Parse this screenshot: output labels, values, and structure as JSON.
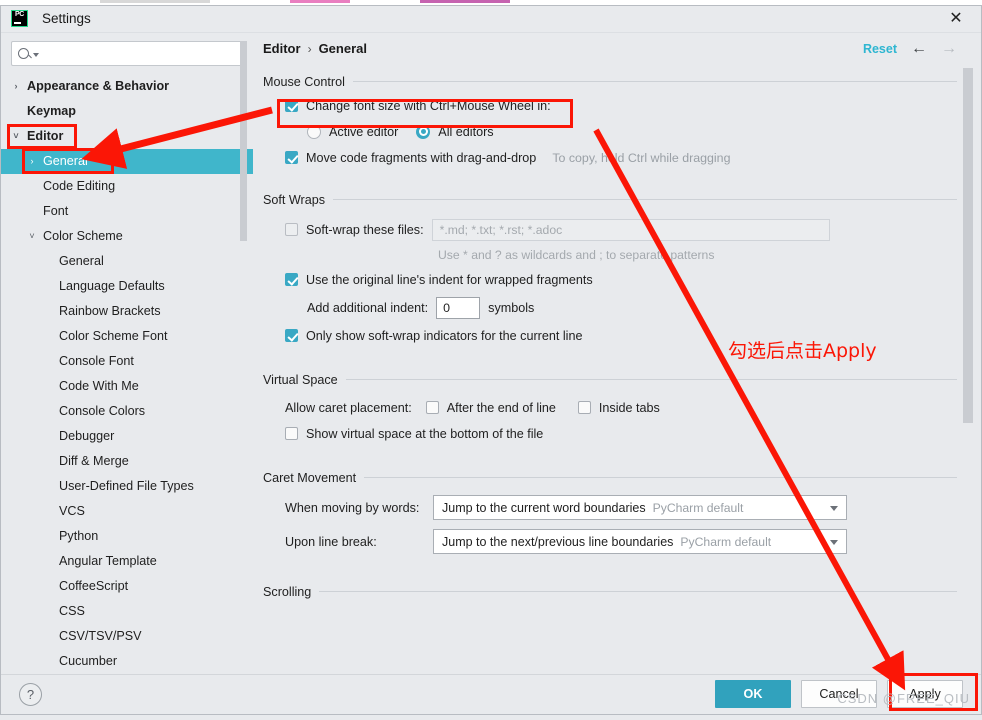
{
  "window": {
    "title": "Settings",
    "app_icon": "pycharm-logo-icon",
    "close_icon": "close-icon"
  },
  "search": {
    "value": "",
    "placeholder": "",
    "icon": "search-icon",
    "caret_icon": "chevron-down-icon"
  },
  "sidebar": {
    "items": [
      {
        "label": "Appearance & Behavior",
        "indent": 0,
        "chevron": "›",
        "bold": true,
        "selected": false
      },
      {
        "label": "Keymap",
        "indent": 0,
        "chevron": "",
        "bold": true,
        "selected": false
      },
      {
        "label": "Editor",
        "indent": 0,
        "chevron": "˅",
        "bold": true,
        "selected": false
      },
      {
        "label": "General",
        "indent": 1,
        "chevron": "›",
        "bold": false,
        "selected": true
      },
      {
        "label": "Code Editing",
        "indent": 1,
        "chevron": "",
        "bold": false,
        "selected": false
      },
      {
        "label": "Font",
        "indent": 1,
        "chevron": "",
        "bold": false,
        "selected": false
      },
      {
        "label": "Color Scheme",
        "indent": 1,
        "chevron": "˅",
        "bold": false,
        "selected": false
      },
      {
        "label": "General",
        "indent": 2,
        "chevron": "",
        "bold": false,
        "selected": false
      },
      {
        "label": "Language Defaults",
        "indent": 2,
        "chevron": "",
        "bold": false,
        "selected": false
      },
      {
        "label": "Rainbow Brackets",
        "indent": 2,
        "chevron": "",
        "bold": false,
        "selected": false
      },
      {
        "label": "Color Scheme Font",
        "indent": 2,
        "chevron": "",
        "bold": false,
        "selected": false
      },
      {
        "label": "Console Font",
        "indent": 2,
        "chevron": "",
        "bold": false,
        "selected": false
      },
      {
        "label": "Code With Me",
        "indent": 2,
        "chevron": "",
        "bold": false,
        "selected": false
      },
      {
        "label": "Console Colors",
        "indent": 2,
        "chevron": "",
        "bold": false,
        "selected": false
      },
      {
        "label": "Debugger",
        "indent": 2,
        "chevron": "",
        "bold": false,
        "selected": false
      },
      {
        "label": "Diff & Merge",
        "indent": 2,
        "chevron": "",
        "bold": false,
        "selected": false
      },
      {
        "label": "User-Defined File Types",
        "indent": 2,
        "chevron": "",
        "bold": false,
        "selected": false
      },
      {
        "label": "VCS",
        "indent": 2,
        "chevron": "",
        "bold": false,
        "selected": false
      },
      {
        "label": "Python",
        "indent": 2,
        "chevron": "",
        "bold": false,
        "selected": false
      },
      {
        "label": "Angular Template",
        "indent": 2,
        "chevron": "",
        "bold": false,
        "selected": false
      },
      {
        "label": "CoffeeScript",
        "indent": 2,
        "chevron": "",
        "bold": false,
        "selected": false
      },
      {
        "label": "CSS",
        "indent": 2,
        "chevron": "",
        "bold": false,
        "selected": false
      },
      {
        "label": "CSV/TSV/PSV",
        "indent": 2,
        "chevron": "",
        "bold": false,
        "selected": false
      },
      {
        "label": "Cucumber",
        "indent": 2,
        "chevron": "",
        "bold": false,
        "selected": false
      }
    ]
  },
  "breadcrumb": {
    "parent": "Editor",
    "separator": "›",
    "current": "General"
  },
  "header_actions": {
    "reset_label": "Reset",
    "back_icon": "arrow-left-icon",
    "forward_icon": "arrow-right-icon"
  },
  "sections": {
    "mouse_control": {
      "title": "Mouse Control",
      "change_font_size": {
        "label": "Change font size with Ctrl+Mouse Wheel in:",
        "checked": true
      },
      "radio_active_editor": {
        "label": "Active editor",
        "selected": false
      },
      "radio_all_editors": {
        "label": "All editors",
        "selected": true
      },
      "move_code_fragments": {
        "label": "Move code fragments with drag-and-drop",
        "checked": true
      },
      "move_code_hint": "To copy, hold Ctrl while dragging"
    },
    "soft_wraps": {
      "title": "Soft Wraps",
      "soft_wrap_files": {
        "label": "Soft-wrap these files:",
        "checked": false,
        "value": "",
        "placeholder": "*.md; *.txt; *.rst; *.adoc"
      },
      "wildcard_hint": "Use * and ? as wildcards and ; to separate patterns",
      "original_indent": {
        "label": "Use the original line's indent for wrapped fragments",
        "checked": true
      },
      "additional_indent": {
        "label": "Add additional indent:",
        "value": "0",
        "unit": "symbols"
      },
      "only_show_indicators": {
        "label": "Only show soft-wrap indicators for the current line",
        "checked": true
      }
    },
    "virtual_space": {
      "title": "Virtual Space",
      "allow_caret_label": "Allow caret placement:",
      "after_end_of_line": {
        "label": "After the end of line",
        "checked": false
      },
      "inside_tabs": {
        "label": "Inside tabs",
        "checked": false
      },
      "show_virtual_space": {
        "label": "Show virtual space at the bottom of the file",
        "checked": false
      }
    },
    "caret_movement": {
      "title": "Caret Movement",
      "when_moving_label": "When moving by words:",
      "when_moving_value": "Jump to the current word boundaries",
      "when_moving_default": "PyCharm default",
      "upon_line_break_label": "Upon line break:",
      "upon_line_break_value": "Jump to the next/previous line boundaries",
      "upon_line_break_default": "PyCharm default"
    },
    "scrolling": {
      "title": "Scrolling"
    }
  },
  "footer": {
    "help_label": "?",
    "ok_label": "OK",
    "cancel_label": "Cancel",
    "apply_label": "Apply"
  },
  "annotations": {
    "note_text": "勾选后点击Apply",
    "highlight_color": "#fb1606"
  },
  "watermark": {
    "text": "CSDN @FREE_QIU"
  }
}
